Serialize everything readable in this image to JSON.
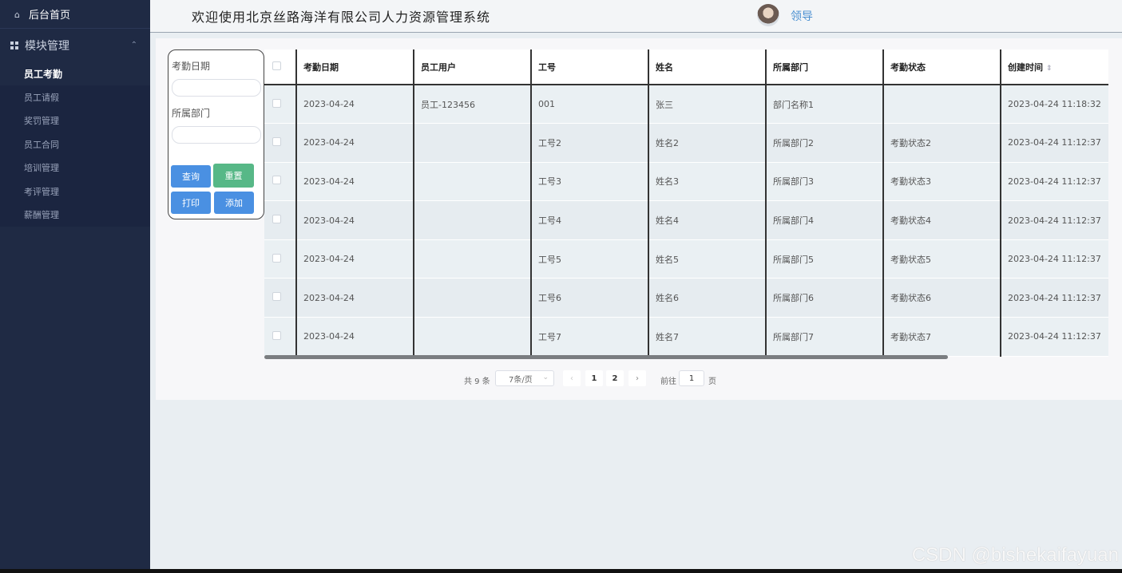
{
  "sidebar": {
    "home_label": "后台首页",
    "module_label": "模块管理",
    "items": [
      {
        "label": "员工考勤",
        "active": true
      },
      {
        "label": "员工请假"
      },
      {
        "label": "奖罚管理"
      },
      {
        "label": "员工合同"
      },
      {
        "label": "培训管理"
      },
      {
        "label": "考评管理"
      },
      {
        "label": "薪酬管理"
      }
    ]
  },
  "header": {
    "title": "欢迎使用北京丝路海洋有限公司人力资源管理系统",
    "user_name": "领导"
  },
  "filter": {
    "date_label": "考勤日期",
    "dept_label": "所属部门",
    "date_value": "",
    "dept_value": "",
    "query_button": "查询",
    "reset_button": "重置",
    "print_button": "打印",
    "add_button": "添加"
  },
  "table": {
    "columns": [
      "考勤日期",
      "员工用户",
      "工号",
      "姓名",
      "所属部门",
      "考勤状态",
      "创建时间"
    ],
    "rows": [
      [
        "2023-04-24",
        "员工-123456",
        "001",
        "张三",
        "部门名称1",
        "",
        "2023-04-24 11:18:32"
      ],
      [
        "2023-04-24",
        "",
        "工号2",
        "姓名2",
        "所属部门2",
        "考勤状态2",
        "2023-04-24 11:12:37"
      ],
      [
        "2023-04-24",
        "",
        "工号3",
        "姓名3",
        "所属部门3",
        "考勤状态3",
        "2023-04-24 11:12:37"
      ],
      [
        "2023-04-24",
        "",
        "工号4",
        "姓名4",
        "所属部门4",
        "考勤状态4",
        "2023-04-24 11:12:37"
      ],
      [
        "2023-04-24",
        "",
        "工号5",
        "姓名5",
        "所属部门5",
        "考勤状态5",
        "2023-04-24 11:12:37"
      ],
      [
        "2023-04-24",
        "",
        "工号6",
        "姓名6",
        "所属部门6",
        "考勤状态6",
        "2023-04-24 11:12:37"
      ],
      [
        "2023-04-24",
        "",
        "工号7",
        "姓名7",
        "所属部门7",
        "考勤状态7",
        "2023-04-24 11:12:37"
      ]
    ]
  },
  "pagination": {
    "total_text": "共 9 条",
    "page_size": "7条/页",
    "pages": [
      "1",
      "2"
    ],
    "current_page": "1",
    "goto_label": "前往",
    "goto_value": "1",
    "page_word": "页"
  },
  "watermark": "CSDN @bishekaifayuan",
  "colors": {
    "sidebar_bg": "#1f2a44",
    "primary_button": "#4a90e2",
    "reset_button": "#57b887",
    "user_name": "#4a8fd1"
  }
}
